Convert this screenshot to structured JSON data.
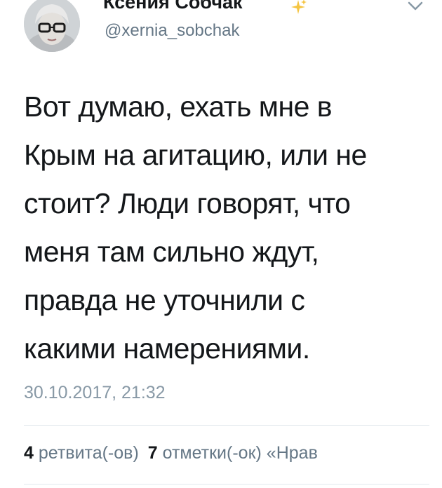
{
  "user": {
    "display_name": "Ксения Собчак",
    "handle": "@xernia_sobchak"
  },
  "tweet": {
    "text": "Вот думаю, ехать мне  в\nКрым на агитацию, или  не\nстоит? Люди говорят, что\nменя там сильно ждут,\nправда не уточнили с\nкакими намерениями.",
    "timestamp": "30.10.2017, 21:32"
  },
  "stats": {
    "retweets_count": "4",
    "retweets_label": "ретвита(-ов)",
    "likes_count": "7",
    "likes_label": "отметки(-ок)",
    "trailing": "«Нрав"
  },
  "icons": {
    "avatar": "avatar",
    "sparkle": "sparkle-icon",
    "menu": "chevron-down-icon"
  }
}
